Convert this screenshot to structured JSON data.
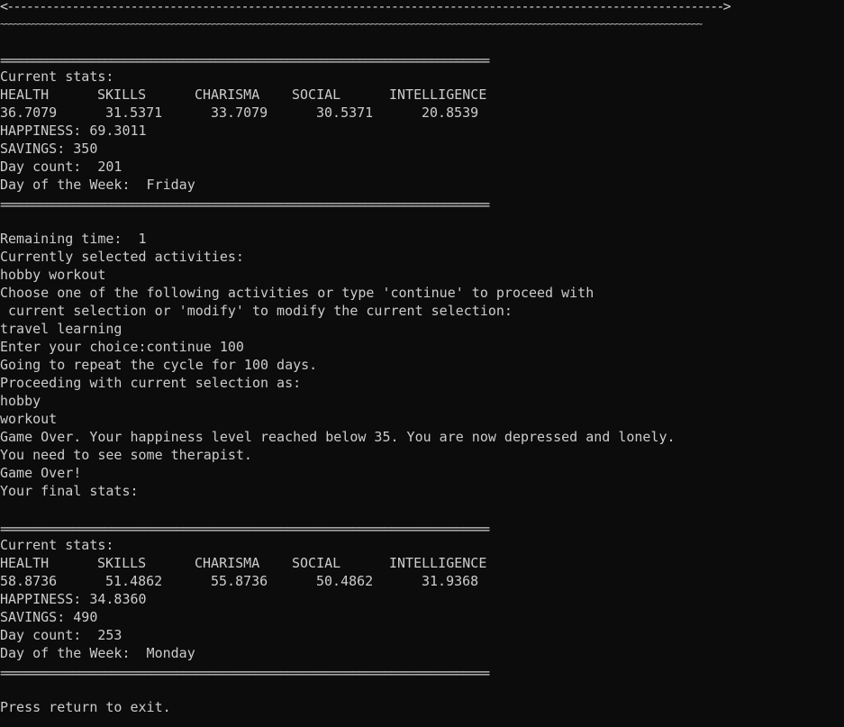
{
  "banner": {
    "arrow_line": "<-------------------------------------------------------------------------------------------------------------->",
    "wave_line": "~~~~~~~~~~~~~~~~~~~~~~~~~~~~~~~~~~~~~~~~~~~~~~~~~~~~~~~~~~~~~~~~~~~~~~~~~~~~~~~~~~~~~~~~~~~~~~~~~~~~~~~~~~~~~~~~~~~~~~~~~~~~~~~~~~~~~~~~~~~~~~~~~~~~~~~~~~~"
  },
  "separator": "===========================================================================",
  "stats_before": {
    "title": "Current stats:",
    "headers": [
      "HEALTH",
      "SKILLS",
      "CHARISMA",
      "SOCIAL",
      "INTELLIGENCE"
    ],
    "values": [
      "36.7079",
      "31.5371",
      "33.7079",
      "30.5371",
      "20.8539"
    ],
    "happiness": "HAPPINESS: 69.3011",
    "savings": "SAVINGS: 350",
    "day_count": "Day count:  201",
    "day_of_week": "Day of the Week:  Friday"
  },
  "session": {
    "remaining_time": "Remaining time:  1",
    "selected_title": "Currently selected activities:",
    "selected_list": "hobby workout",
    "prompt_line1": "Choose one of the following activities or type 'continue' to proceed with",
    "prompt_line2": " current selection or 'modify' to modify the current selection:",
    "options": "travel learning",
    "entry": "Enter your choice:continue 100",
    "repeat": "Going to repeat the cycle for 100 days.",
    "proceeding": "Proceeding with current selection as:",
    "activity_1": "hobby",
    "activity_2": "workout",
    "game_over_msg": "Game Over. Your happiness level reached below 35. You are now depressed and lonely.",
    "therapist": "You need to see some therapist.",
    "game_over": "Game Over!",
    "final_stats": "Your final stats:"
  },
  "stats_after": {
    "title": "Current stats:",
    "headers": [
      "HEALTH",
      "SKILLS",
      "CHARISMA",
      "SOCIAL",
      "INTELLIGENCE"
    ],
    "values": [
      "58.8736",
      "51.4862",
      "55.8736",
      "50.4862",
      "31.9368"
    ],
    "happiness": "HAPPINESS: 34.8360",
    "savings": "SAVINGS: 490",
    "day_count": "Day count:  253",
    "day_of_week": "Day of the Week:  Monday"
  },
  "exit_prompt": "Press return to exit."
}
